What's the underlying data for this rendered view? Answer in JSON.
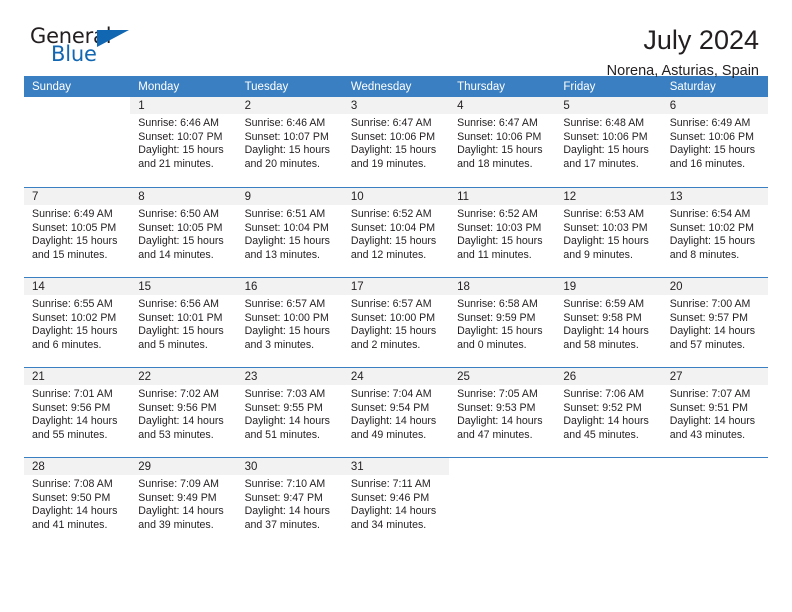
{
  "brand": {
    "name_part1": "General",
    "name_part2": "Blue",
    "accent_color": "#1267b2"
  },
  "header": {
    "title": "July 2024",
    "subtitle": "Norena, Asturias, Spain"
  },
  "calendar": {
    "header_color": "#3a7fc1",
    "weekdays": [
      "Sunday",
      "Monday",
      "Tuesday",
      "Wednesday",
      "Thursday",
      "Friday",
      "Saturday"
    ],
    "weeks": [
      [
        {
          "day": "",
          "lines": []
        },
        {
          "day": "1",
          "lines": [
            "Sunrise: 6:46 AM",
            "Sunset: 10:07 PM",
            "Daylight: 15 hours",
            "and 21 minutes."
          ]
        },
        {
          "day": "2",
          "lines": [
            "Sunrise: 6:46 AM",
            "Sunset: 10:07 PM",
            "Daylight: 15 hours",
            "and 20 minutes."
          ]
        },
        {
          "day": "3",
          "lines": [
            "Sunrise: 6:47 AM",
            "Sunset: 10:06 PM",
            "Daylight: 15 hours",
            "and 19 minutes."
          ]
        },
        {
          "day": "4",
          "lines": [
            "Sunrise: 6:47 AM",
            "Sunset: 10:06 PM",
            "Daylight: 15 hours",
            "and 18 minutes."
          ]
        },
        {
          "day": "5",
          "lines": [
            "Sunrise: 6:48 AM",
            "Sunset: 10:06 PM",
            "Daylight: 15 hours",
            "and 17 minutes."
          ]
        },
        {
          "day": "6",
          "lines": [
            "Sunrise: 6:49 AM",
            "Sunset: 10:06 PM",
            "Daylight: 15 hours",
            "and 16 minutes."
          ]
        }
      ],
      [
        {
          "day": "7",
          "lines": [
            "Sunrise: 6:49 AM",
            "Sunset: 10:05 PM",
            "Daylight: 15 hours",
            "and 15 minutes."
          ]
        },
        {
          "day": "8",
          "lines": [
            "Sunrise: 6:50 AM",
            "Sunset: 10:05 PM",
            "Daylight: 15 hours",
            "and 14 minutes."
          ]
        },
        {
          "day": "9",
          "lines": [
            "Sunrise: 6:51 AM",
            "Sunset: 10:04 PM",
            "Daylight: 15 hours",
            "and 13 minutes."
          ]
        },
        {
          "day": "10",
          "lines": [
            "Sunrise: 6:52 AM",
            "Sunset: 10:04 PM",
            "Daylight: 15 hours",
            "and 12 minutes."
          ]
        },
        {
          "day": "11",
          "lines": [
            "Sunrise: 6:52 AM",
            "Sunset: 10:03 PM",
            "Daylight: 15 hours",
            "and 11 minutes."
          ]
        },
        {
          "day": "12",
          "lines": [
            "Sunrise: 6:53 AM",
            "Sunset: 10:03 PM",
            "Daylight: 15 hours",
            "and 9 minutes."
          ]
        },
        {
          "day": "13",
          "lines": [
            "Sunrise: 6:54 AM",
            "Sunset: 10:02 PM",
            "Daylight: 15 hours",
            "and 8 minutes."
          ]
        }
      ],
      [
        {
          "day": "14",
          "lines": [
            "Sunrise: 6:55 AM",
            "Sunset: 10:02 PM",
            "Daylight: 15 hours",
            "and 6 minutes."
          ]
        },
        {
          "day": "15",
          "lines": [
            "Sunrise: 6:56 AM",
            "Sunset: 10:01 PM",
            "Daylight: 15 hours",
            "and 5 minutes."
          ]
        },
        {
          "day": "16",
          "lines": [
            "Sunrise: 6:57 AM",
            "Sunset: 10:00 PM",
            "Daylight: 15 hours",
            "and 3 minutes."
          ]
        },
        {
          "day": "17",
          "lines": [
            "Sunrise: 6:57 AM",
            "Sunset: 10:00 PM",
            "Daylight: 15 hours",
            "and 2 minutes."
          ]
        },
        {
          "day": "18",
          "lines": [
            "Sunrise: 6:58 AM",
            "Sunset: 9:59 PM",
            "Daylight: 15 hours",
            "and 0 minutes."
          ]
        },
        {
          "day": "19",
          "lines": [
            "Sunrise: 6:59 AM",
            "Sunset: 9:58 PM",
            "Daylight: 14 hours",
            "and 58 minutes."
          ]
        },
        {
          "day": "20",
          "lines": [
            "Sunrise: 7:00 AM",
            "Sunset: 9:57 PM",
            "Daylight: 14 hours",
            "and 57 minutes."
          ]
        }
      ],
      [
        {
          "day": "21",
          "lines": [
            "Sunrise: 7:01 AM",
            "Sunset: 9:56 PM",
            "Daylight: 14 hours",
            "and 55 minutes."
          ]
        },
        {
          "day": "22",
          "lines": [
            "Sunrise: 7:02 AM",
            "Sunset: 9:56 PM",
            "Daylight: 14 hours",
            "and 53 minutes."
          ]
        },
        {
          "day": "23",
          "lines": [
            "Sunrise: 7:03 AM",
            "Sunset: 9:55 PM",
            "Daylight: 14 hours",
            "and 51 minutes."
          ]
        },
        {
          "day": "24",
          "lines": [
            "Sunrise: 7:04 AM",
            "Sunset: 9:54 PM",
            "Daylight: 14 hours",
            "and 49 minutes."
          ]
        },
        {
          "day": "25",
          "lines": [
            "Sunrise: 7:05 AM",
            "Sunset: 9:53 PM",
            "Daylight: 14 hours",
            "and 47 minutes."
          ]
        },
        {
          "day": "26",
          "lines": [
            "Sunrise: 7:06 AM",
            "Sunset: 9:52 PM",
            "Daylight: 14 hours",
            "and 45 minutes."
          ]
        },
        {
          "day": "27",
          "lines": [
            "Sunrise: 7:07 AM",
            "Sunset: 9:51 PM",
            "Daylight: 14 hours",
            "and 43 minutes."
          ]
        }
      ],
      [
        {
          "day": "28",
          "lines": [
            "Sunrise: 7:08 AM",
            "Sunset: 9:50 PM",
            "Daylight: 14 hours",
            "and 41 minutes."
          ]
        },
        {
          "day": "29",
          "lines": [
            "Sunrise: 7:09 AM",
            "Sunset: 9:49 PM",
            "Daylight: 14 hours",
            "and 39 minutes."
          ]
        },
        {
          "day": "30",
          "lines": [
            "Sunrise: 7:10 AM",
            "Sunset: 9:47 PM",
            "Daylight: 14 hours",
            "and 37 minutes."
          ]
        },
        {
          "day": "31",
          "lines": [
            "Sunrise: 7:11 AM",
            "Sunset: 9:46 PM",
            "Daylight: 14 hours",
            "and 34 minutes."
          ]
        },
        {
          "day": "",
          "lines": []
        },
        {
          "day": "",
          "lines": []
        },
        {
          "day": "",
          "lines": []
        }
      ]
    ]
  }
}
